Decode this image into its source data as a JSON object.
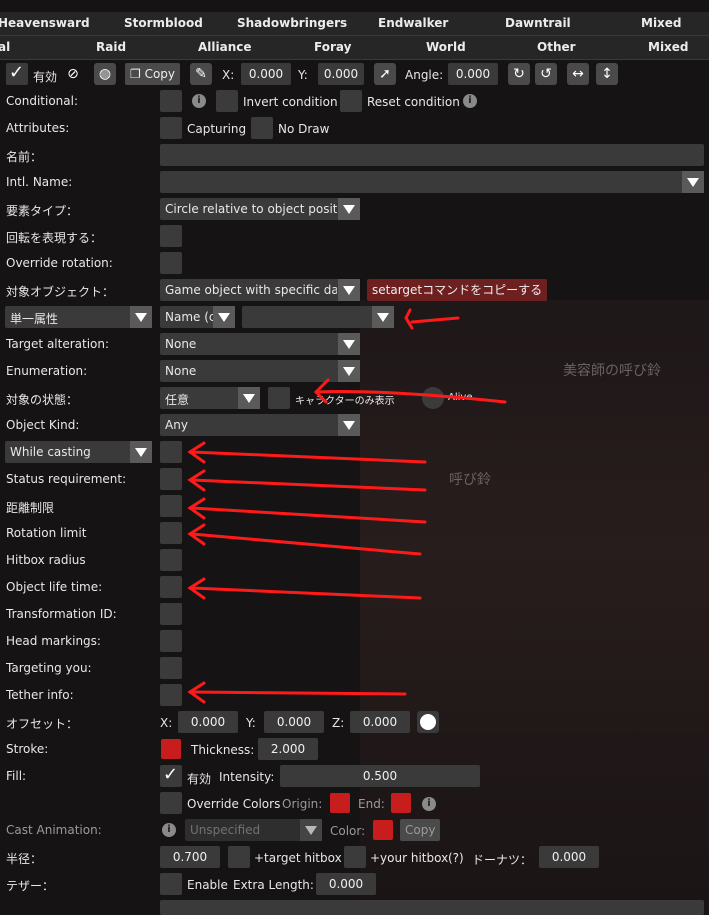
{
  "tabs_row1": [
    "Heavensward",
    "Stormblood",
    "Shadowbringers",
    "Endwalker",
    "Dawntrail",
    "Mixed"
  ],
  "tabs_row2": [
    "al",
    "Raid",
    "Alliance",
    "Foray",
    "World",
    "Other",
    "Mixed"
  ],
  "toolbar": {
    "enabled_label": "有効",
    "copy_label": "Copy",
    "x_label": "X:",
    "x_value": "0.000",
    "y_label": "Y:",
    "y_value": "0.000",
    "angle_label": "Angle:",
    "angle_value": "0.000"
  },
  "fields": {
    "conditional": "Conditional:",
    "invert_condition": "Invert condition",
    "reset_condition": "Reset condition",
    "attributes": "Attributes:",
    "capturing": "Capturing",
    "no_draw": "No Draw",
    "name": "名前：",
    "intl_name": "Intl. Name:",
    "element_type": "要素タイプ：",
    "element_type_value": "Circle relative to object positio",
    "express_rotation": "回転を表現する：",
    "override_rotation": "Override rotation:",
    "target_object": "対象オブジェクト：",
    "target_object_value": "Game object with specific data",
    "copy_settarget": "setargetコマンドをコピーする",
    "single_attr": "単一属性",
    "name_c": "Name (c",
    "target_alteration": "Target alteration:",
    "target_alteration_value": "None",
    "enumeration": "Enumeration:",
    "enumeration_value": "None",
    "target_state": "対象の状態：",
    "target_state_value": "任意",
    "character_only": "キャラクターのみ表示",
    "alive": "Alive",
    "object_kind": "Object Kind:",
    "object_kind_value": "Any",
    "while_casting": "While casting",
    "status_requirement": "Status requirement:",
    "distance_limit": "距離制限",
    "rotation_limit": "Rotation limit",
    "hitbox_radius": "Hitbox radius",
    "object_life_time": "Object life time:",
    "transformation_id": "Transformation ID:",
    "head_markings": "Head markings:",
    "targeting_you": "Targeting you:",
    "tether_info": "Tether info:",
    "offset": "オフセット：",
    "off_x_label": "X:",
    "off_x": "0.000",
    "off_y_label": "Y:",
    "off_y": "0.000",
    "off_z_label": "Z:",
    "off_z": "0.000",
    "stroke": "Stroke:",
    "thickness_label": "Thickness:",
    "thickness": "2.000",
    "fill": "Fill:",
    "fill_enabled": "有効",
    "intensity_label": "Intensity:",
    "intensity": "0.500",
    "override_colors": "Override Colors",
    "origin_label": "Origin:",
    "end_label": "End:",
    "cast_animation": "Cast Animation:",
    "cast_animation_value": "Unspecified",
    "color_label": "Color:",
    "copy_label": "Copy",
    "radius": "半径：",
    "radius_value": "0.700",
    "target_hitbox": "+target hitbox",
    "your_hitbox": "+your hitbox",
    "q_mark": "(?)",
    "donut": "ドーナツ：",
    "donut_value": "0.000",
    "tether": "テザー：",
    "tether_enable": "Enable",
    "extra_length_label": "Extra Length:",
    "extra_length": "0.000"
  },
  "background": {
    "text1": "美容師の呼び鈴",
    "text2": "呼び鈴"
  },
  "colors": {
    "accent_red": "#c81d1d",
    "annotation_red": "#ff1a1a"
  }
}
